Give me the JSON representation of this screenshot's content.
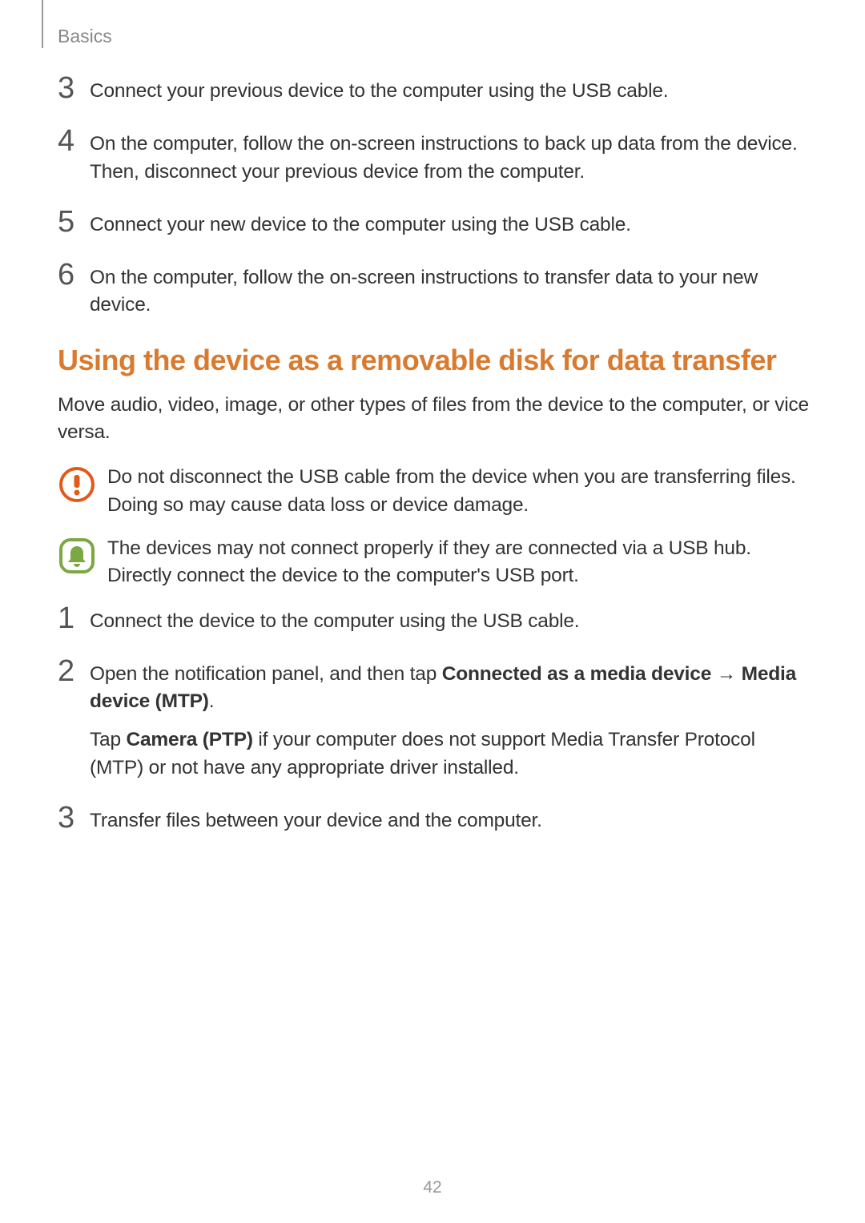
{
  "header": {
    "section": "Basics"
  },
  "steps_top": [
    {
      "num": "3",
      "text": "Connect your previous device to the computer using the USB cable."
    },
    {
      "num": "4",
      "text": "On the computer, follow the on-screen instructions to back up data from the device. Then, disconnect your previous device from the computer."
    },
    {
      "num": "5",
      "text": "Connect your new device to the computer using the USB cable."
    },
    {
      "num": "6",
      "text": "On the computer, follow the on-screen instructions to transfer data to your new device."
    }
  ],
  "heading": "Using the device as a removable disk for data transfer",
  "intro": "Move audio, video, image, or other types of files from the device to the computer, or vice versa.",
  "warning_note": "Do not disconnect the USB cable from the device when you are transferring files. Doing so may cause data loss or device damage.",
  "info_note": "The devices may not connect properly if they are connected via a USB hub. Directly connect the device to the computer's USB port.",
  "steps_bottom": {
    "s1": {
      "num": "1",
      "text": "Connect the device to the computer using the USB cable."
    },
    "s2": {
      "num": "2",
      "prefix": "Open the notification panel, and then tap ",
      "bold1": "Connected as a media device",
      "arrow": " → ",
      "bold2": "Media device (MTP)",
      "suffix": ".",
      "sub_prefix": "Tap ",
      "sub_bold": "Camera (PTP)",
      "sub_suffix": " if your computer does not support Media Transfer Protocol (MTP) or not have any appropriate driver installed."
    },
    "s3": {
      "num": "3",
      "text": "Transfer files between your device and the computer."
    }
  },
  "page_number": "42"
}
